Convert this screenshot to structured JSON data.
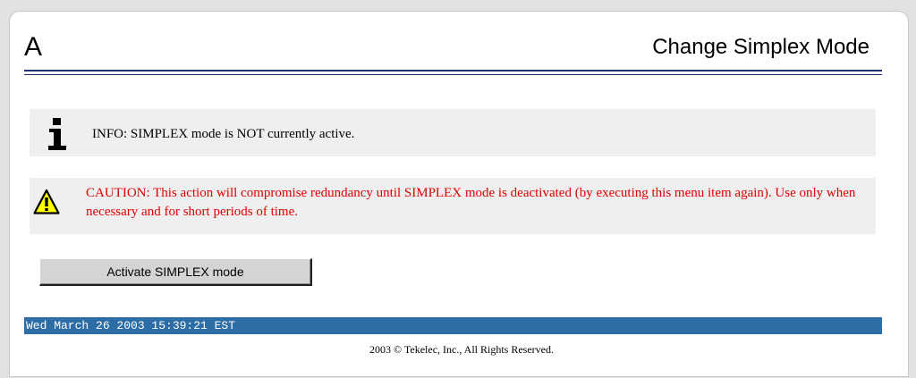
{
  "header": {
    "logo_letter": "A",
    "title": "Change Simplex Mode"
  },
  "info": {
    "icon": "info-icon",
    "text": "INFO: SIMPLEX mode is NOT currently active."
  },
  "caution": {
    "icon": "warning-triangle-icon",
    "text": "CAUTION: This action will compromise redundancy until SIMPLEX mode is deactivated (by executing this menu item again). Use only when necessary and for short periods of time.",
    "color": "#e00000"
  },
  "actions": {
    "activate_label": "Activate SIMPLEX mode"
  },
  "status_bar": {
    "datetime": "Wed March 26 2003 15:39:21 EST",
    "color": "#2d6da6"
  },
  "footer": {
    "copyright": "2003 © Tekelec, Inc., All Rights Reserved."
  },
  "colors": {
    "rule": "#1f2e78",
    "message_bg": "#efefef"
  }
}
